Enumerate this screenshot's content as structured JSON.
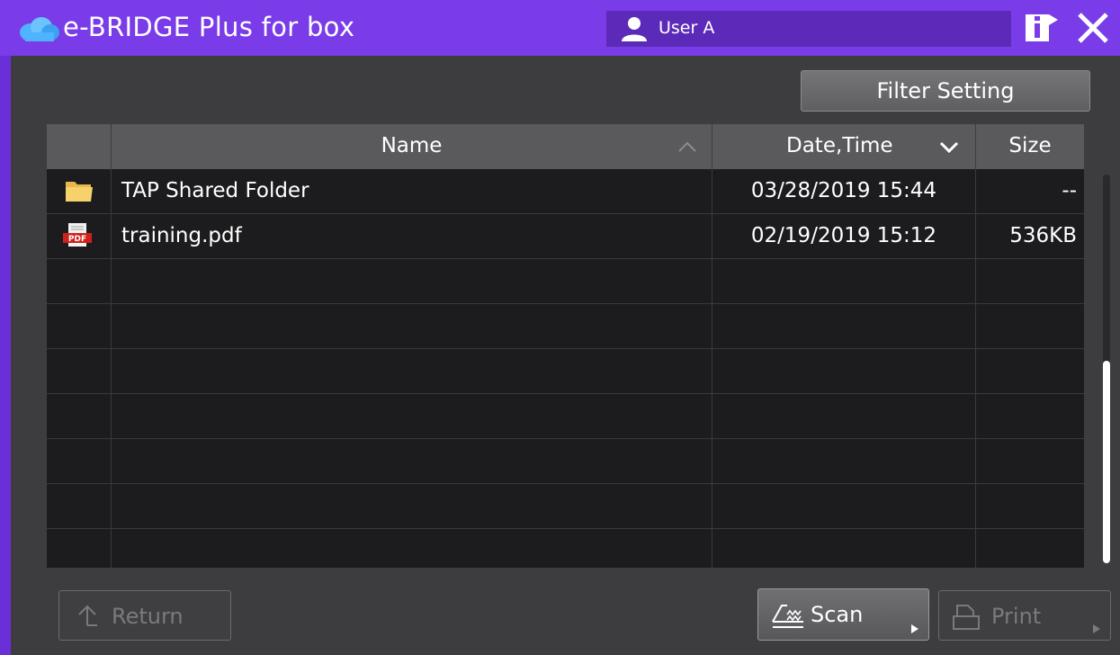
{
  "titlebar": {
    "app_title": "e-BRIDGE Plus for box",
    "user_name": "User A",
    "info_icon": "info-icon",
    "close_icon": "close-icon",
    "accent_color": "#7a3ce8"
  },
  "toolbar": {
    "filter_label": "Filter Setting"
  },
  "table": {
    "columns": {
      "name": "Name",
      "date": "Date,Time",
      "size": "Size"
    },
    "sort": {
      "name": "ascending-chevron",
      "date": "descending-chevron"
    },
    "rows": [
      {
        "icon": "folder-icon",
        "name": "TAP Shared Folder",
        "date": "03/28/2019 15:44",
        "size": "--"
      },
      {
        "icon": "pdf-file-icon",
        "name": "training.pdf",
        "date": "02/19/2019 15:12",
        "size": "536KB"
      }
    ],
    "empty_rows": 7
  },
  "scrollbar": {
    "position": 0.5
  },
  "buttons": {
    "return_label": "Return",
    "scan_label": "Scan",
    "print_label": "Print"
  }
}
